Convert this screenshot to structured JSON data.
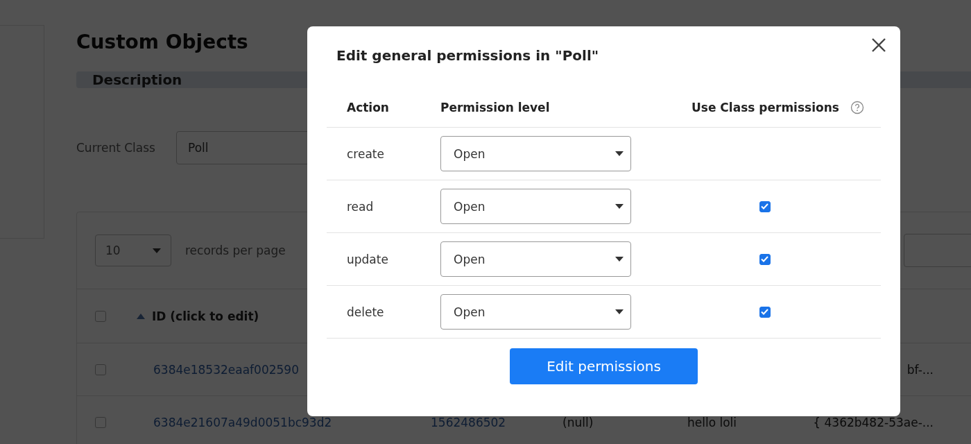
{
  "page": {
    "title": "Custom Objects",
    "description_header": "Description",
    "current_class_label": "Current Class",
    "current_class_value": "Poll",
    "page_size": "10",
    "page_size_label": "records per page",
    "table": {
      "header_checked": false,
      "id_column": "ID (click to edit)",
      "rows": [
        {
          "checked": false,
          "id": "6384e18532eaaf002590",
          "tail": "bf-..."
        },
        {
          "checked": false,
          "id": "6384e21607a49d0051bc93d2",
          "col_2": "1562486502",
          "col_3": "(null)",
          "col_4": "hello loli",
          "tail": "{ 4362b482-53ae-..."
        }
      ]
    }
  },
  "modal": {
    "title": "Edit general permissions in \"Poll\"",
    "columns": [
      "Action",
      "Permission level",
      "Use Class permissions"
    ],
    "rows": [
      {
        "action": "create",
        "level": "Open"
      },
      {
        "action": "read",
        "level": "Open",
        "checked": true
      },
      {
        "action": "update",
        "level": "Open",
        "checked": true
      },
      {
        "action": "delete",
        "level": "Open",
        "checked": true
      }
    ],
    "button": "Edit permissions"
  }
}
